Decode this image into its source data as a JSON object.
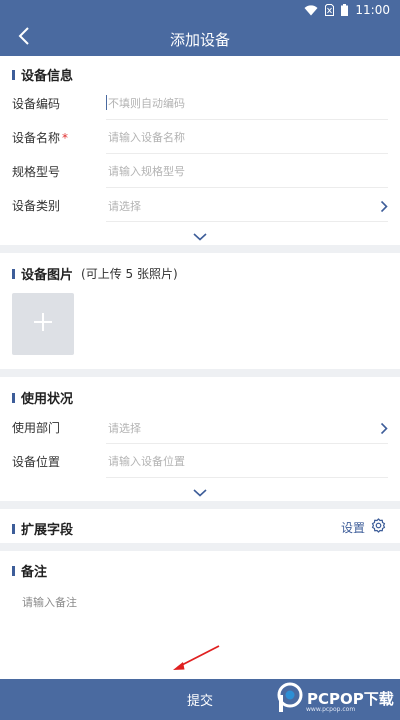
{
  "status": {
    "time": "11:00"
  },
  "header": {
    "title": "添加设备",
    "back_icon": "chevron-left-icon"
  },
  "device_info": {
    "title": "设备信息",
    "fields": [
      {
        "label": "设备编码",
        "placeholder": "不填则自动编码",
        "required": false
      },
      {
        "label": "设备名称",
        "placeholder": "请输入设备名称",
        "required": true,
        "required_mark": "*"
      },
      {
        "label": "规格型号",
        "placeholder": "请输入规格型号",
        "required": false
      },
      {
        "label": "设备类别",
        "placeholder": "请选择",
        "required": false
      }
    ]
  },
  "device_images": {
    "title": "设备图片",
    "note": "(可上传 5 张照片)",
    "add_icon": "plus-icon"
  },
  "usage": {
    "title": "使用状况",
    "fields": [
      {
        "label": "使用部门",
        "placeholder": "请选择"
      },
      {
        "label": "设备位置",
        "placeholder": "请输入设备位置"
      }
    ]
  },
  "extended": {
    "title": "扩展字段",
    "settings_label": "设置",
    "settings_icon": "gear-icon"
  },
  "remark": {
    "title": "备注",
    "placeholder": "请输入备注"
  },
  "submit": {
    "label": "提交"
  },
  "watermark": {
    "text": "PCPOP下载",
    "sub": "www.pcpop.com"
  },
  "colors": {
    "primary": "#4a6aa0",
    "accent": "#3d5d99",
    "required": "#e03030",
    "annotation": "#e02020"
  }
}
